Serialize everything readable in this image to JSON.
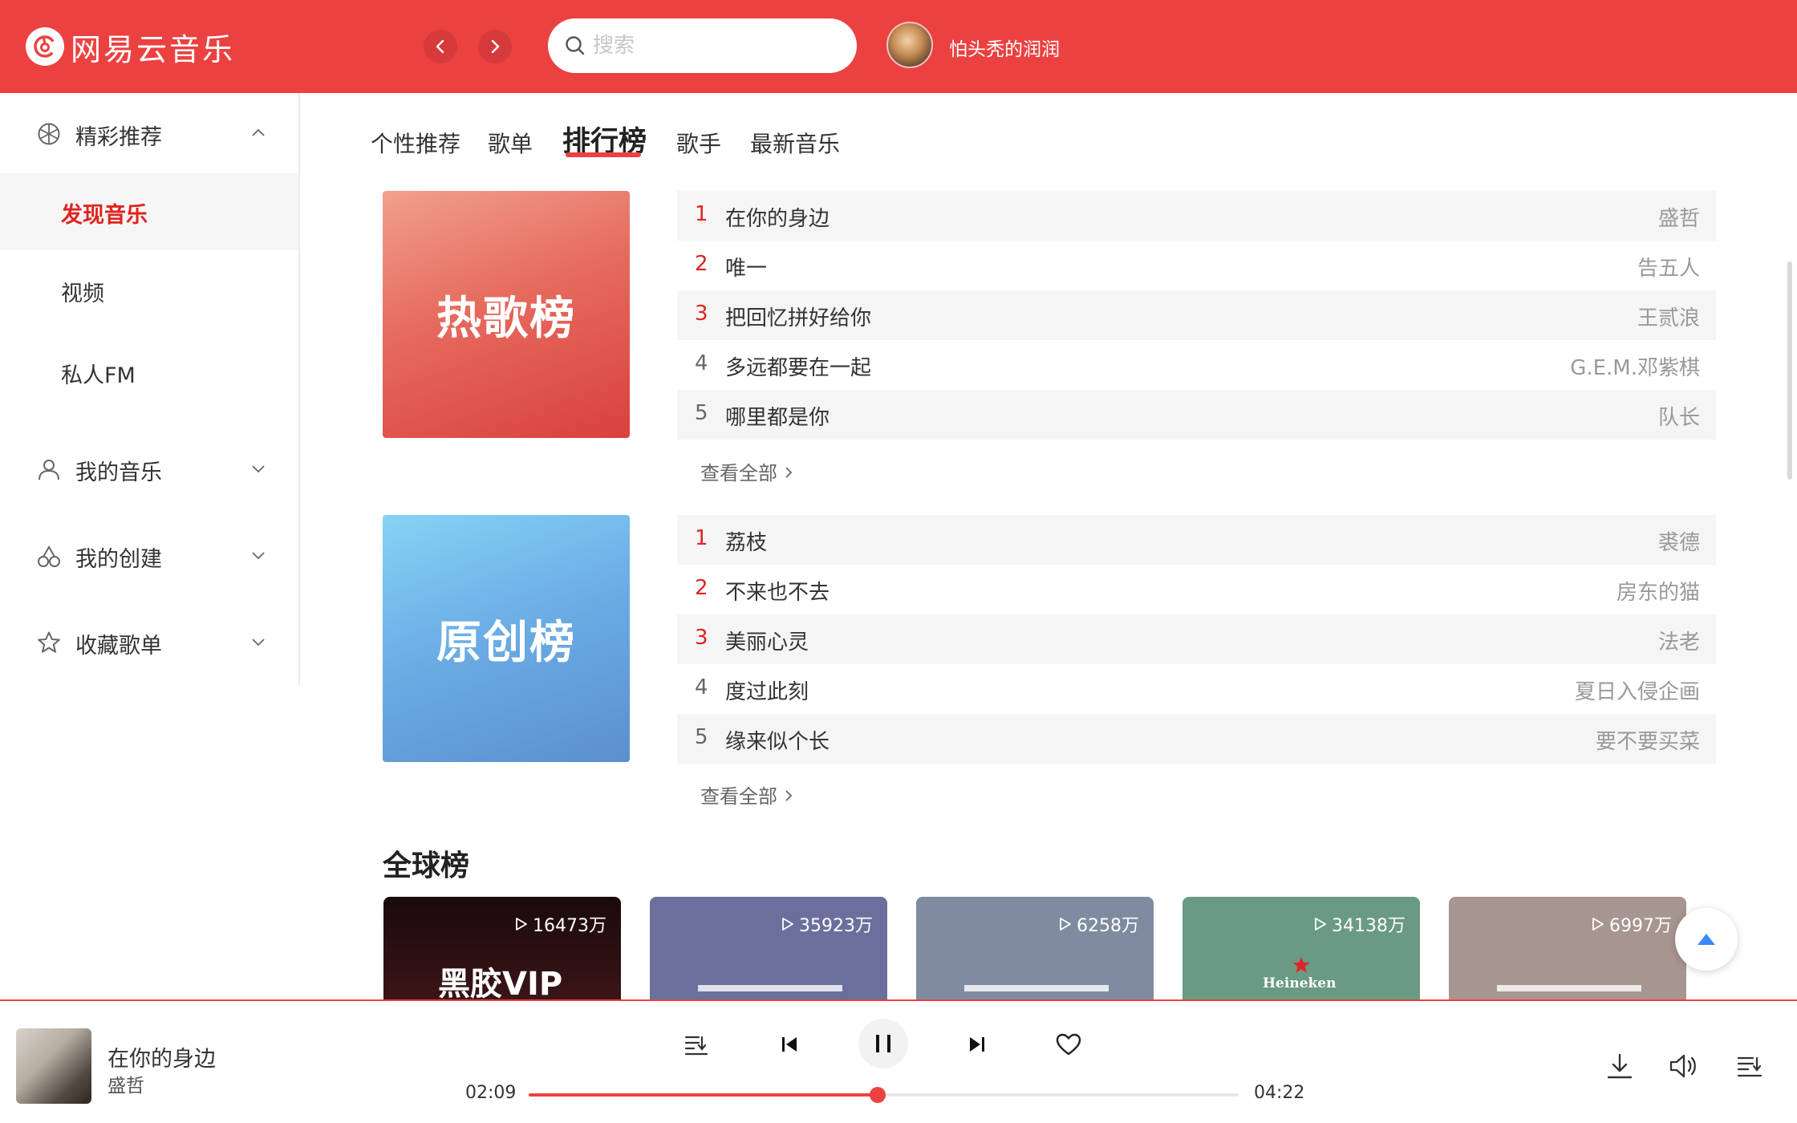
{
  "app": {
    "logo_text": "网易云音乐",
    "user": {
      "name": "怕头秃的润润"
    },
    "search": {
      "placeholder": "搜索",
      "value": ""
    }
  },
  "sidebar": {
    "groups": [
      {
        "label": "精彩推荐",
        "icon": "aperture-icon",
        "expanded": true
      },
      {
        "label": "我的音乐",
        "icon": "user-icon",
        "expanded": false
      },
      {
        "label": "我的创建",
        "icon": "cherries-icon",
        "expanded": false
      },
      {
        "label": "收藏歌单",
        "icon": "star-icon",
        "expanded": false
      }
    ],
    "items": [
      {
        "label": "发现音乐",
        "active": true
      },
      {
        "label": "视频",
        "active": false
      },
      {
        "label": "私人FM",
        "active": false
      }
    ]
  },
  "tabs": [
    {
      "label": "个性推荐",
      "active": false
    },
    {
      "label": "歌单",
      "active": false
    },
    {
      "label": "排行榜",
      "active": true
    },
    {
      "label": "歌手",
      "active": false
    },
    {
      "label": "最新音乐",
      "active": false
    }
  ],
  "charts": [
    {
      "title": "热歌榜",
      "view_all": "查看全部",
      "songs": [
        {
          "rank": "1",
          "name": "在你的身边",
          "artist": "盛哲"
        },
        {
          "rank": "2",
          "name": "唯一",
          "artist": "告五人"
        },
        {
          "rank": "3",
          "name": "把回忆拼好给你",
          "artist": "王贰浪"
        },
        {
          "rank": "4",
          "name": "多远都要在一起",
          "artist": "G.E.M.邓紫棋"
        },
        {
          "rank": "5",
          "name": "哪里都是你",
          "artist": "队长"
        }
      ]
    },
    {
      "title": "原创榜",
      "view_all": "查看全部",
      "songs": [
        {
          "rank": "1",
          "name": "荔枝",
          "artist": "裘德"
        },
        {
          "rank": "2",
          "name": "不来也不去",
          "artist": "房东的猫"
        },
        {
          "rank": "3",
          "name": "美丽心灵",
          "artist": "法老"
        },
        {
          "rank": "4",
          "name": "度过此刻",
          "artist": "夏日入侵企画"
        },
        {
          "rank": "5",
          "name": "缘来似个长",
          "artist": "要不要买菜"
        }
      ]
    }
  ],
  "global": {
    "title": "全球榜",
    "cards": [
      {
        "plays": "16473万",
        "color": "#2a1012",
        "logo": "黑胶VIP"
      },
      {
        "plays": "35923万",
        "color": "#6b6f9c"
      },
      {
        "plays": "6258万",
        "color": "#7f8c9f"
      },
      {
        "plays": "34138万",
        "color": "#6a9a84",
        "logo": "Heineken"
      },
      {
        "plays": "6997万",
        "color": "#a79590"
      }
    ]
  },
  "player": {
    "title": "在你的身边",
    "artist": "盛哲",
    "current_time": "02:09",
    "total_time": "04:22",
    "progress": 0.492
  },
  "colors": {
    "brand": "#ec4141",
    "rank_top": "#e0241f"
  }
}
